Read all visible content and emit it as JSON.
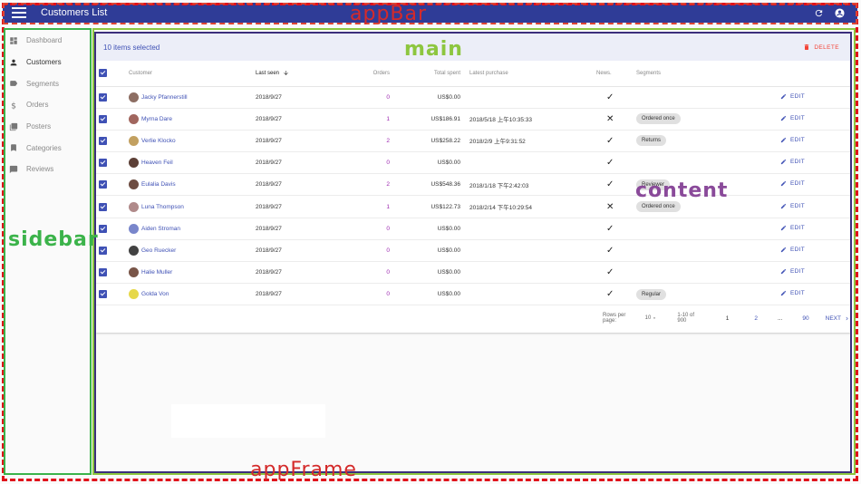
{
  "annotations": {
    "appbar": "appBar",
    "main": "main",
    "content": "content",
    "sidebar": "sidebar",
    "appframe": "appFrame"
  },
  "appbar": {
    "title": "Customers List",
    "icons": [
      "menu-icon",
      "refresh-icon",
      "account-icon"
    ]
  },
  "sidebar": {
    "items": [
      {
        "label": "Dashboard",
        "icon": "dashboard-icon"
      },
      {
        "label": "Customers",
        "icon": "person-icon"
      },
      {
        "label": "Segments",
        "icon": "label-icon"
      },
      {
        "label": "Orders",
        "icon": "dollar-icon"
      },
      {
        "label": "Posters",
        "icon": "collections-icon"
      },
      {
        "label": "Categories",
        "icon": "bookmark-icon"
      },
      {
        "label": "Reviews",
        "icon": "comment-icon"
      }
    ]
  },
  "selection": {
    "text": "10 items selected",
    "delete_label": "DELETE"
  },
  "table": {
    "headers": {
      "customer": "Customer",
      "last_seen": "Last seen",
      "orders": "Orders",
      "total_spent": "Total spent",
      "latest_purchase": "Latest purchase",
      "news": "News.",
      "segments": "Segments"
    },
    "edit_label": "EDIT",
    "rows": [
      {
        "name": "Jacky Pfannerstill",
        "last_seen": "2018/9/27",
        "orders": "0",
        "total": "US$0.00",
        "latest": "",
        "news": "✓",
        "segment": ""
      },
      {
        "name": "Myrna Dare",
        "last_seen": "2018/9/27",
        "orders": "1",
        "total": "US$186.91",
        "latest": "2018/5/18 上午10:35:33",
        "news": "✕",
        "segment": "Ordered once"
      },
      {
        "name": "Verlie Klocko",
        "last_seen": "2018/9/27",
        "orders": "2",
        "total": "US$258.22",
        "latest": "2018/2/9 上午9:31:52",
        "news": "✓",
        "segment": "Returns"
      },
      {
        "name": "Heaven Feil",
        "last_seen": "2018/9/27",
        "orders": "0",
        "total": "US$0.00",
        "latest": "",
        "news": "✓",
        "segment": ""
      },
      {
        "name": "Eulalia Davis",
        "last_seen": "2018/9/27",
        "orders": "2",
        "total": "US$548.36",
        "latest": "2018/1/18 下午2:42:03",
        "news": "✓",
        "segment": "Reviewer"
      },
      {
        "name": "Luna Thompson",
        "last_seen": "2018/9/27",
        "orders": "1",
        "total": "US$122.73",
        "latest": "2018/2/14 下午10:29:54",
        "news": "✕",
        "segment": "Ordered once"
      },
      {
        "name": "Aiden Stroman",
        "last_seen": "2018/9/27",
        "orders": "0",
        "total": "US$0.00",
        "latest": "",
        "news": "✓",
        "segment": ""
      },
      {
        "name": "Geo Ruecker",
        "last_seen": "2018/9/27",
        "orders": "0",
        "total": "US$0.00",
        "latest": "",
        "news": "✓",
        "segment": ""
      },
      {
        "name": "Halie Muller",
        "last_seen": "2018/9/27",
        "orders": "0",
        "total": "US$0.00",
        "latest": "",
        "news": "✓",
        "segment": ""
      },
      {
        "name": "Golda Von",
        "last_seen": "2018/9/27",
        "orders": "0",
        "total": "US$0.00",
        "latest": "",
        "news": "✓",
        "segment": "Regular"
      }
    ]
  },
  "pagination": {
    "rows_per_page_label": "Rows per page:",
    "rows_per_page": "10",
    "range": "1-10 of 900",
    "pages": [
      "1",
      "2",
      "...",
      "90"
    ],
    "next_label": "NEXT"
  },
  "colors": {
    "appbar": "#2f3c97",
    "primary": "#3f51b5",
    "accent": "#9c27b0",
    "delete": "#f44336"
  }
}
